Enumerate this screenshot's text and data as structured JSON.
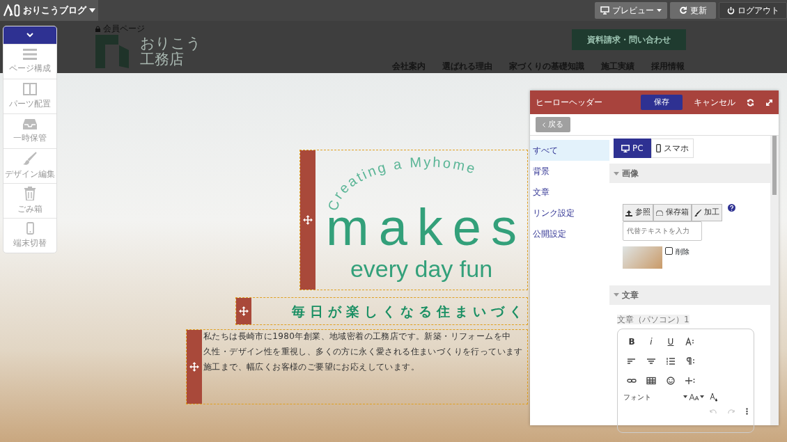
{
  "top_bar": {
    "brand": "おりこうブログ",
    "buttons": [
      {
        "label": "プレビュー",
        "kind": "preview"
      },
      {
        "label": "更新",
        "kind": "update"
      },
      {
        "label": "ログアウト",
        "kind": "logout"
      }
    ]
  },
  "site_header": {
    "member_link": "会員ページ",
    "logo_lines": [
      "おりこう",
      "工務店"
    ],
    "cta": "資料請求・問い合わせ",
    "nav": [
      "会社案内",
      "選ばれる理由",
      "家づくりの基礎知識",
      "施工実績",
      "採用情報"
    ]
  },
  "left_toolbar": {
    "expanded": true,
    "items": [
      {
        "label": "ページ構成"
      },
      {
        "label": "パーツ配置"
      },
      {
        "label": "一時保管"
      },
      {
        "label": "デザイン編集"
      },
      {
        "label": "ごみ箱"
      },
      {
        "label": "端末切替"
      }
    ]
  },
  "hero": {
    "arc_text": "Creating a Myhome",
    "headline": "makes",
    "subline": "every day fun",
    "catch": "毎日が楽しくなる住まいづく",
    "body_lines": [
      "私たちは長崎市に1980年創業、地域密着の工務店です。新築・リフォームを中",
      "久性・デザイン性を重視し、多くの方に永く愛される住まいづくりを行っています",
      "施工まで、幅広くお客様のご要望にお応えしています。"
    ]
  },
  "editor_panel": {
    "title": "ヒーローヘッダー",
    "save": "保存",
    "cancel": "キャンセル",
    "back": "戻る",
    "sections": [
      {
        "label": "すべて",
        "selected": true
      },
      {
        "label": "背景",
        "selected": false
      },
      {
        "label": "文章",
        "selected": false
      },
      {
        "label": "リンク設定",
        "selected": false
      },
      {
        "label": "公開設定",
        "selected": false
      }
    ],
    "device_tabs": [
      {
        "label": "PC",
        "selected": true
      },
      {
        "label": "スマホ",
        "selected": false
      }
    ],
    "image_group": {
      "title": "画像",
      "buttons": [
        "参照",
        "保存箱",
        "加工"
      ],
      "alt_placeholder": "代替テキストを入力",
      "delete_label": "削除",
      "delete_checked": false
    },
    "text_group": {
      "title": "文章",
      "field_label": "文章（パソコン）1",
      "format_buttons": [
        "B",
        "i",
        "U"
      ],
      "font_label": "フォント"
    }
  }
}
